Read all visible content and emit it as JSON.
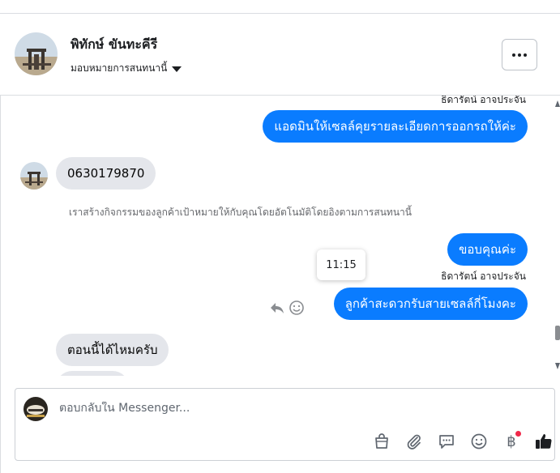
{
  "header": {
    "contact_name": "พิทักษ์ ขันทะคีรี",
    "assign_label": "มอบหมายการสนทนานี้"
  },
  "messages": [
    {
      "direction": "outgoing",
      "sender": "ธิดารัตน์ อาจประจัน",
      "text": "แอดมินให้เซลล์คุยรายละเอียดการออกรถให้ค่ะ"
    },
    {
      "direction": "incoming",
      "text": "0630179870"
    },
    {
      "direction": "system",
      "text": "เราสร้างกิจกรรมของลูกค้าเป้าหมายให้กับคุณโดยอัตโนมัติโดยอิงตามการสนทนานี้"
    },
    {
      "direction": "outgoing",
      "text": "ขอบคุณค่ะ"
    },
    {
      "direction": "outgoing",
      "sender": "ธิดารัตน์ อาจประจัน",
      "text": "ลูกค้าสะดวกรับสายเซลล์กี่โมงคะ"
    },
    {
      "direction": "incoming",
      "text": "ตอนนี้ได้ไหมครับ"
    }
  ],
  "tooltip_time": "11:15",
  "composer": {
    "placeholder": "ตอบกลับใน Messenger...",
    "value": ""
  },
  "toolbar_icons": [
    "shopping-bag-icon",
    "paperclip-icon",
    "saved-reply-icon",
    "emoji-icon",
    "baht-payment-icon",
    "thumbs-up-icon"
  ],
  "baht_symbol": "฿",
  "colors": {
    "outgoing_bubble": "#0a7cff",
    "incoming_bubble": "#e4e6eb",
    "notification_dot": "#f02849",
    "border": "#dadde1"
  }
}
